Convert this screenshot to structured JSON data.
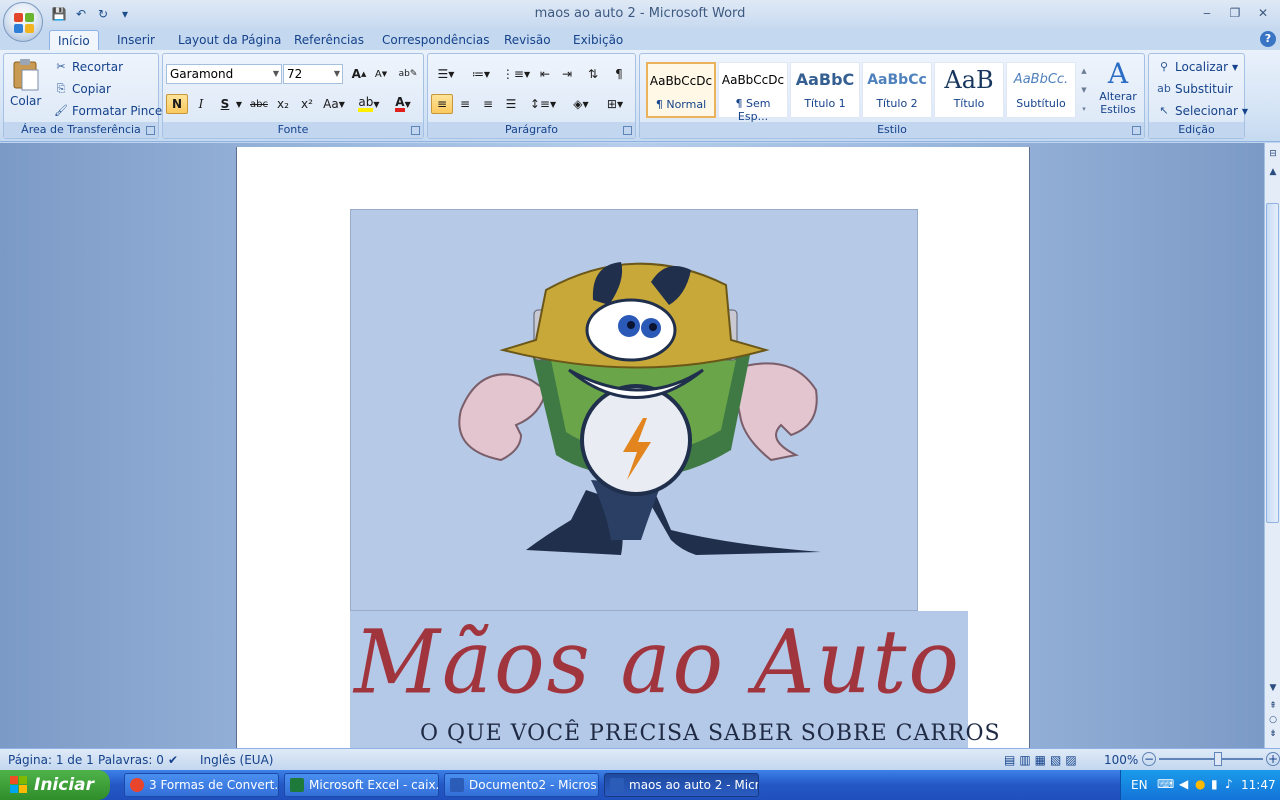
{
  "window": {
    "title": "maos ao auto 2 - Microsoft Word",
    "minimize": "‒",
    "restore": "❐",
    "close": "✕"
  },
  "qat": {
    "save": "💾",
    "undo": "↶",
    "redo": "↻",
    "customize": "▾"
  },
  "tabs": [
    "Início",
    "Inserir",
    "Layout da Página",
    "Referências",
    "Correspondências",
    "Revisão",
    "Exibição"
  ],
  "active_tab": "Início",
  "help": "?",
  "ribbon": {
    "clipboard": {
      "label": "Área de Transferência",
      "paste": "Colar",
      "cut": "Recortar",
      "copy": "Copiar",
      "format_painter": "Formatar Pincel"
    },
    "font": {
      "label": "Fonte",
      "font_name": "Garamond",
      "font_size": "72",
      "bold": "N",
      "italic": "I",
      "underline": "S",
      "strike": "abc",
      "subscript": "x₂",
      "superscript": "x²",
      "case": "Aa",
      "grow": "A",
      "shrink": "A"
    },
    "paragraph": {
      "label": "Parágrafo"
    },
    "styles": {
      "label": "Estilo",
      "items": [
        {
          "preview": "AaBbCcDc",
          "name": "¶ Normal"
        },
        {
          "preview": "AaBbCcDc",
          "name": "¶ Sem Esp..."
        },
        {
          "preview": "AaBbC",
          "name": "Título 1"
        },
        {
          "preview": "AaBbCc",
          "name": "Título 2"
        },
        {
          "preview": "AaB",
          "name": "Título"
        },
        {
          "preview": "AaBbCc.",
          "name": "Subtítulo"
        }
      ],
      "change_styles": "Alterar Estilos"
    },
    "editing": {
      "label": "Edição",
      "find": "Localizar",
      "replace": "Substituir",
      "select": "Selecionar"
    }
  },
  "document": {
    "banner_title": "Mãos ao Auto",
    "banner_subtitle": "O QUE VOCÊ PRECISA SABER SOBRE CARROS"
  },
  "status": {
    "page": "Página: 1 de 1",
    "words": "Palavras: 0",
    "language": "Inglês (EUA)",
    "zoom": "100%"
  },
  "taskbar": {
    "start": "Iniciar",
    "tasks": [
      {
        "label": "3 Formas de Convert...",
        "color": "#e8452c"
      },
      {
        "label": "Microsoft Excel - caix...",
        "color": "#1e7a3a"
      },
      {
        "label": "Documento2 - Micros...",
        "color": "#2b5cb8"
      },
      {
        "label": "maos ao auto 2 - Micr...",
        "color": "#2b5cb8"
      }
    ],
    "active_task": 3,
    "lang": "EN",
    "clock": "11:47"
  }
}
